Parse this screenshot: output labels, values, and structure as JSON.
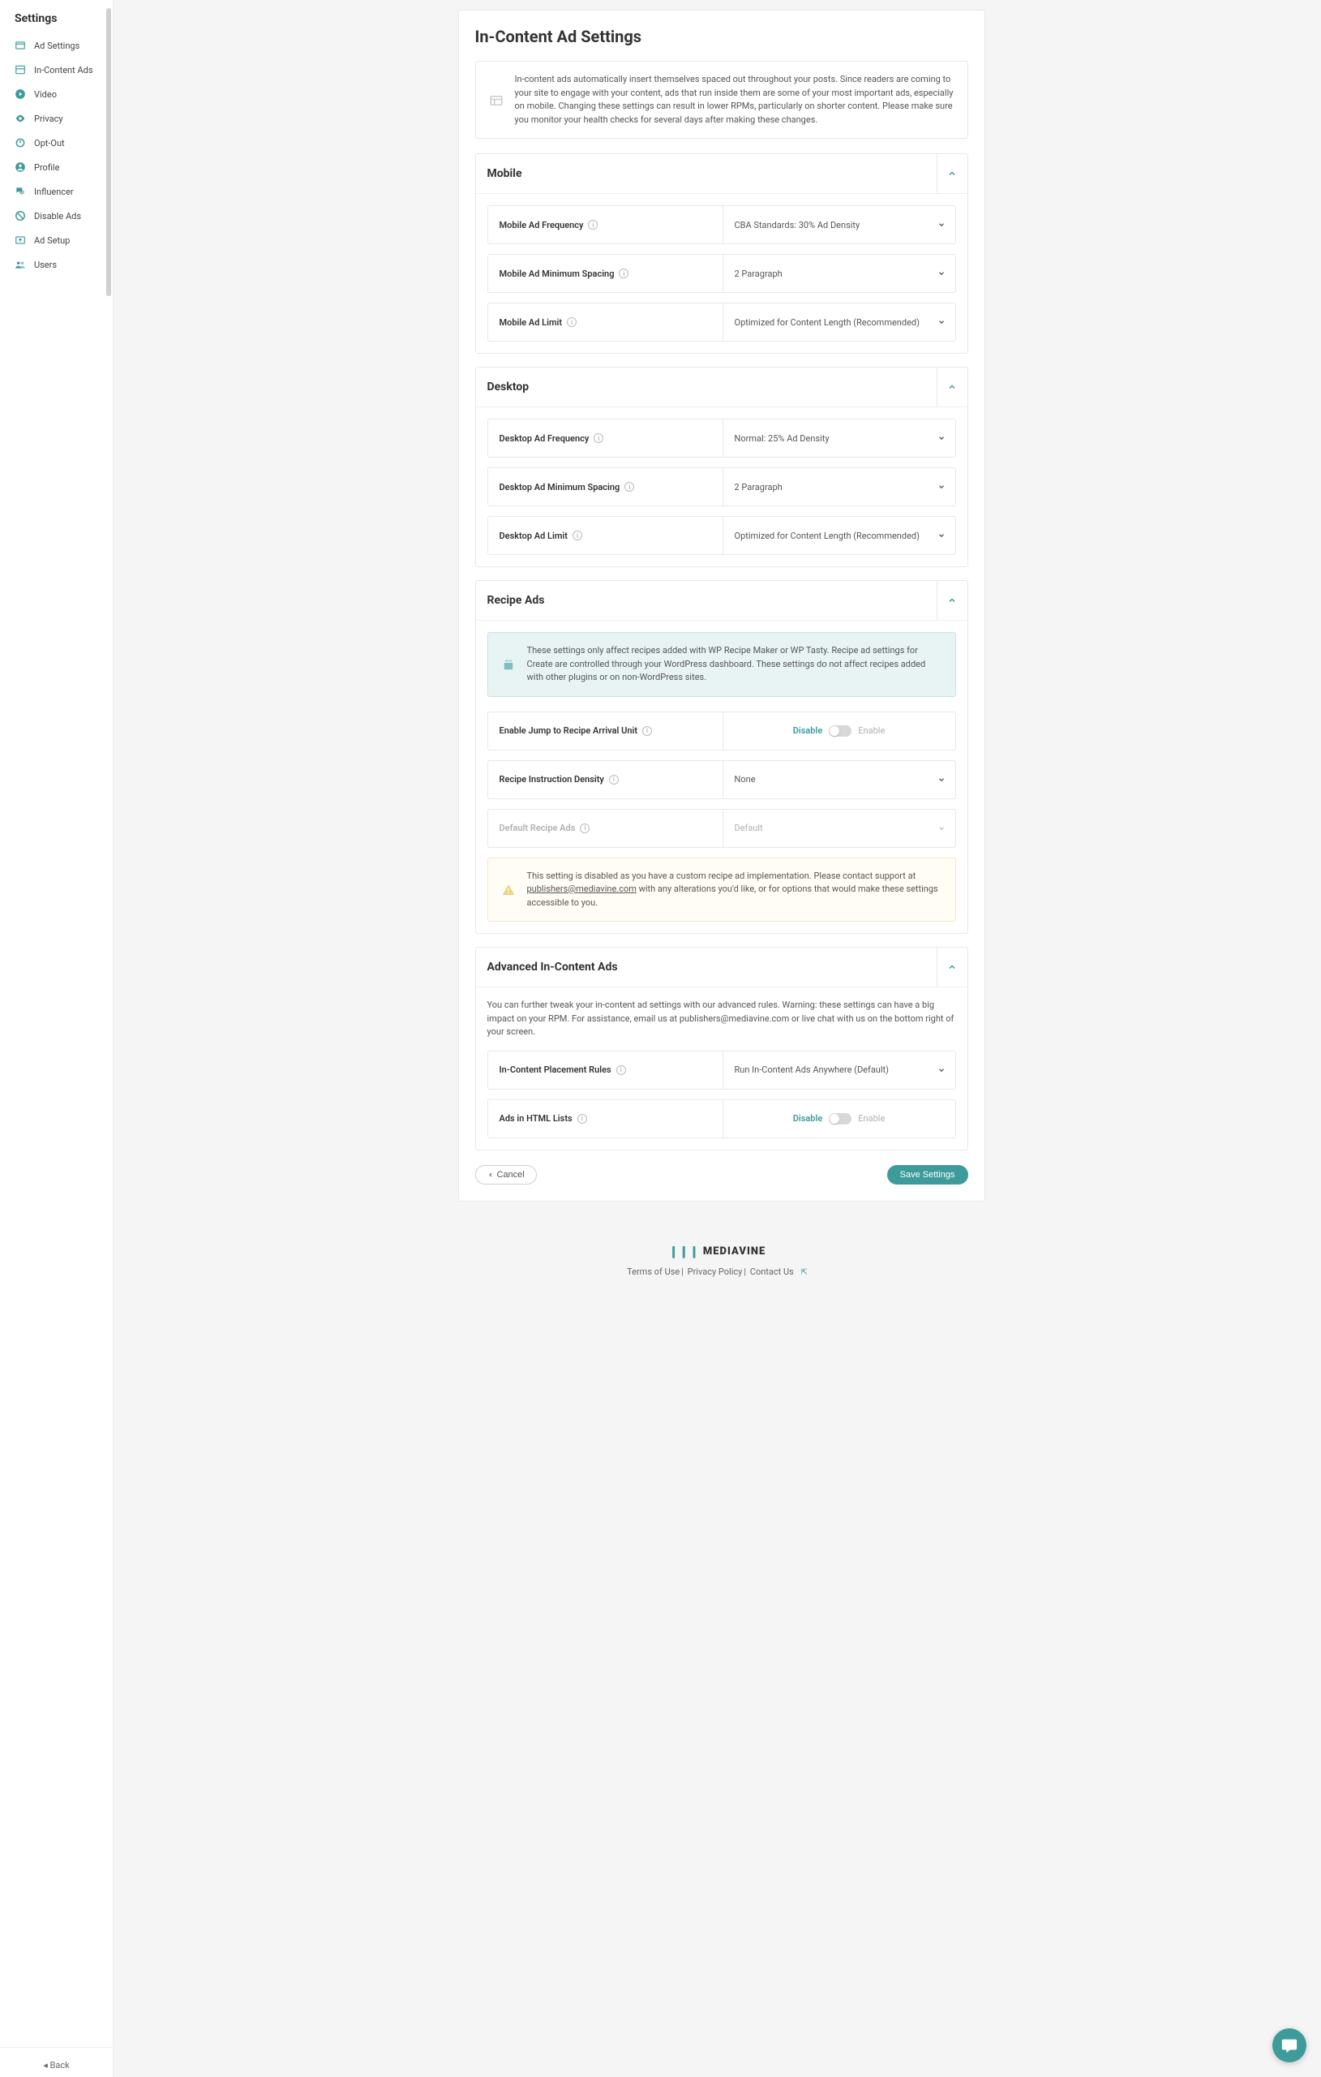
{
  "sidebar": {
    "title": "Settings",
    "items": [
      {
        "label": "Ad Settings",
        "icon": "window-icon"
      },
      {
        "label": "In-Content Ads",
        "icon": "layout-icon"
      },
      {
        "label": "Video",
        "icon": "play-icon"
      },
      {
        "label": "Privacy",
        "icon": "eye-icon"
      },
      {
        "label": "Opt-Out",
        "icon": "power-icon"
      },
      {
        "label": "Profile",
        "icon": "user-icon"
      },
      {
        "label": "Influencer",
        "icon": "chat-icon"
      },
      {
        "label": "Disable Ads",
        "icon": "block-icon"
      },
      {
        "label": "Ad Setup",
        "icon": "upload-icon"
      },
      {
        "label": "Users",
        "icon": "users-icon"
      }
    ],
    "back": "Back"
  },
  "page": {
    "title": "In-Content Ad Settings",
    "intro": "In-content ads automatically insert themselves spaced out throughout your posts. Since readers are coming to your site to engage with your content, ads that run inside them are some of your most important ads, especially on mobile. Changing these settings can result in lower RPMs, particularly on shorter content. Please make sure you monitor your health checks for several days after making these changes."
  },
  "mobile": {
    "title": "Mobile",
    "freq_label": "Mobile Ad Frequency",
    "freq_value": "CBA Standards: 30% Ad Density",
    "spacing_label": "Mobile Ad Minimum Spacing",
    "spacing_value": "2 Paragraph",
    "limit_label": "Mobile Ad Limit",
    "limit_value": "Optimized for Content Length (Recommended)"
  },
  "desktop": {
    "title": "Desktop",
    "freq_label": "Desktop Ad Frequency",
    "freq_value": "Normal: 25% Ad Density",
    "spacing_label": "Desktop Ad Minimum Spacing",
    "spacing_value": "2 Paragraph",
    "limit_label": "Desktop Ad Limit",
    "limit_value": "Optimized for Content Length (Recommended)"
  },
  "recipe": {
    "title": "Recipe Ads",
    "note": "These settings only affect recipes added with WP Recipe Maker or WP Tasty. Recipe ad settings for Create are controlled through your WordPress dashboard. These settings do not affect recipes added with other plugins or on non-WordPress sites.",
    "jump_label": "Enable Jump to Recipe Arrival Unit",
    "density_label": "Recipe Instruction Density",
    "density_value": "None",
    "default_label": "Default Recipe Ads",
    "default_value": "Default",
    "warning_prefix": "This setting is disabled as you have a custom recipe ad implementation. Please contact support at ",
    "warning_email": "publishers@mediavine.com",
    "warning_suffix": " with any alterations you'd like, or for options that would make these settings accessible to you."
  },
  "advanced": {
    "title": "Advanced In-Content Ads",
    "note": "You can further tweak your in-content ad settings with our advanced rules. Warning: these settings can have a big impact on your RPM. For assistance, email us at publishers@mediavine.com or live chat with us on the bottom right of your screen.",
    "placement_label": "In-Content Placement Rules",
    "placement_value": "Run In-Content Ads Anywhere (Default)",
    "html_lists_label": "Ads in HTML Lists"
  },
  "toggle": {
    "disable": "Disable",
    "enable": "Enable"
  },
  "actions": {
    "cancel": "Cancel",
    "save": "Save Settings"
  },
  "footer": {
    "brand": "MEDIAVINE",
    "terms": "Terms of Use",
    "privacy": "Privacy Policy",
    "contact": "Contact Us"
  }
}
